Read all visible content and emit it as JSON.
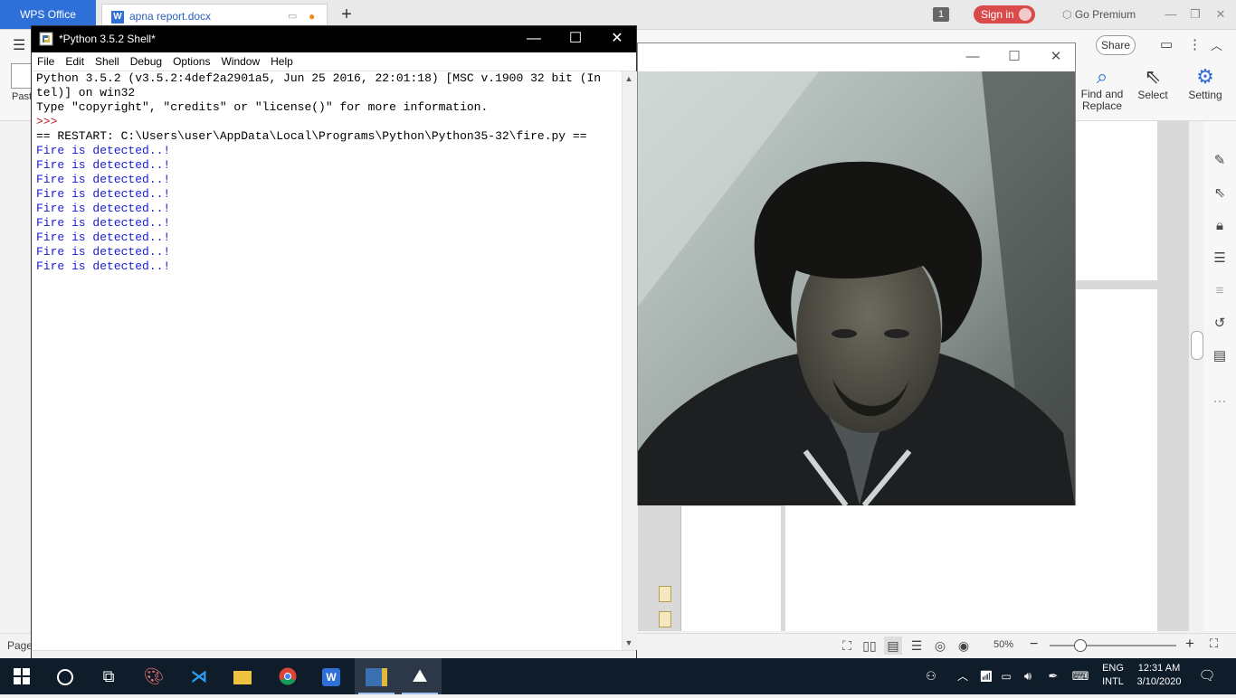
{
  "wps": {
    "home_tab": "WPS Office",
    "doc_tab": "apna report.docx",
    "tab_count": "1",
    "sign_in": "Sign in",
    "go_premium": "Go Premium",
    "share": "Share",
    "tools": {
      "find_replace": "Find and Replace",
      "select": "Select",
      "setting": "Setting",
      "paste": "Past"
    },
    "status": {
      "page": "Page",
      "zoom": "50%"
    }
  },
  "python_shell": {
    "title": "*Python 3.5.2 Shell*",
    "menu": [
      "File",
      "Edit",
      "Shell",
      "Debug",
      "Options",
      "Window",
      "Help"
    ],
    "lines": {
      "banner1": "Python 3.5.2 (v3.5.2:4def2a2901a5, Jun 25 2016, 22:01:18) [MSC v.1900 32 bit (In",
      "banner2": "tel)] on win32",
      "banner3": "Type \"copyright\", \"credits\" or \"license()\" for more information.",
      "prompt": ">>> ",
      "restart": "== RESTART: C:\\Users\\user\\AppData\\Local\\Programs\\Python\\Python35-32\\fire.py ==",
      "output": "Fire is detected..!"
    },
    "output_count": 9
  },
  "taskbar": {
    "lang1": "ENG",
    "lang2": "INTL",
    "time": "12:31 AM",
    "date": "3/10/2020"
  },
  "colors": {
    "wps_blue": "#2e6fd8",
    "sign_in_red": "#d94a4a",
    "shell_output_blue": "#1a1ad6",
    "shell_prompt_red": "#c21f1f",
    "taskbar": "#0f1c2a"
  }
}
